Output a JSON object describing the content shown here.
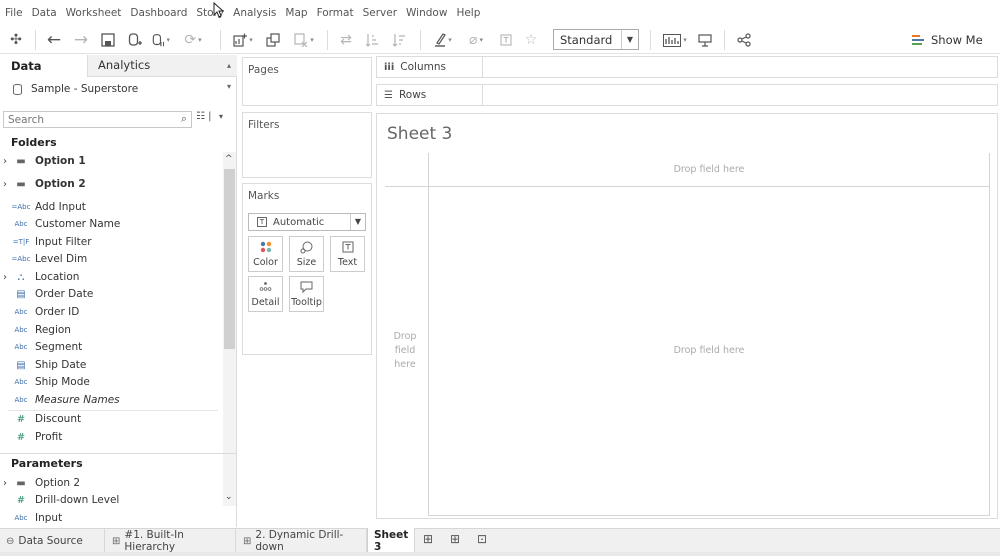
{
  "menu": [
    "File",
    "Data",
    "Worksheet",
    "Dashboard",
    "Story",
    "Analysis",
    "Map",
    "Format",
    "Server",
    "Window",
    "Help"
  ],
  "toolbar": {
    "fit_value": "Standard",
    "show_me_label": "Show Me"
  },
  "left_pane": {
    "tab_data": "Data",
    "tab_analytics": "Analytics",
    "datasource": "Sample - Superstore",
    "search_placeholder": "Search",
    "folders_header": "Folders",
    "parameters_header": "Parameters",
    "fields": [
      {
        "name": "Option 1",
        "icon": "folder",
        "expandable": true,
        "bold": true
      },
      {
        "name": "Option 2",
        "icon": "folder",
        "expandable": true,
        "bold": true
      },
      {
        "name": "Add Input",
        "icon": "=Abc"
      },
      {
        "name": "Customer Name",
        "icon": "Abc"
      },
      {
        "name": "Input Filter",
        "icon": "=T|F"
      },
      {
        "name": "Level Dim",
        "icon": "=Abc"
      },
      {
        "name": "Location",
        "icon": "hierarchy",
        "expandable": true
      },
      {
        "name": "Order Date",
        "icon": "calendar"
      },
      {
        "name": "Order ID",
        "icon": "Abc"
      },
      {
        "name": "Region",
        "icon": "Abc"
      },
      {
        "name": "Segment",
        "icon": "Abc"
      },
      {
        "name": "Ship Date",
        "icon": "calendar"
      },
      {
        "name": "Ship Mode",
        "icon": "Abc"
      },
      {
        "name": "Measure Names",
        "icon": "Abc",
        "italic": true
      },
      {
        "name": "Discount",
        "icon": "#"
      },
      {
        "name": "Profit",
        "icon": "#"
      }
    ],
    "parameters": [
      {
        "name": "Option 2",
        "icon": "folder",
        "expandable": true
      },
      {
        "name": "Drill-down Level",
        "icon": "#"
      },
      {
        "name": "Input",
        "icon": "Abc"
      }
    ]
  },
  "cards": {
    "pages": "Pages",
    "filters": "Filters",
    "marks": "Marks",
    "marks_type": "Automatic",
    "mark_buttons": [
      "Color",
      "Size",
      "Text",
      "Detail",
      "Tooltip"
    ]
  },
  "shelves": {
    "columns": "Columns",
    "rows": "Rows"
  },
  "sheet": {
    "title": "Sheet 3",
    "drop_top": "Drop field here",
    "drop_center": "Drop field here",
    "drop_left": "Drop field here"
  },
  "tabs": {
    "data_source": "Data Source",
    "sheet_tabs": [
      "#1. Built-In Hierarchy",
      "2. Dynamic Drill-down",
      "Sheet 3"
    ]
  },
  "colors": {
    "show_me_bars": [
      "#e8762d",
      "#4e79a7",
      "#59a14f"
    ],
    "color_dots": [
      "#4e79a7",
      "#f28e2b",
      "#e15759",
      "#76b7b2"
    ],
    "field_blue": "#3e6fa8",
    "field_green": "#2f8a73"
  }
}
